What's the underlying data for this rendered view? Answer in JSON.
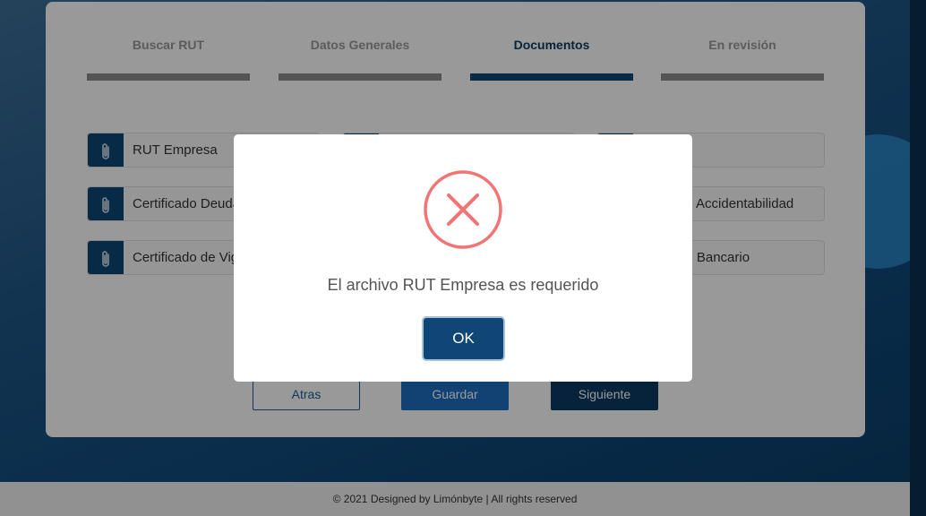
{
  "steps": [
    {
      "label": "Buscar RUT",
      "active": false
    },
    {
      "label": "Datos Generales",
      "active": false
    },
    {
      "label": "Documentos",
      "active": true
    },
    {
      "label": "En revisión",
      "active": false
    }
  ],
  "documents": {
    "col1": [
      "RUT Empresa",
      "Certificado Deuda",
      "Certificado de Vig"
    ],
    "col3": [
      "a",
      "do Accidentabilidad",
      "do Bancario"
    ]
  },
  "buttons": {
    "back": "Atras",
    "save": "Guardar",
    "next": "Siguiente"
  },
  "footer": {
    "text": "© 2021 Designed by Limónbyte | All rights reserved"
  },
  "modal": {
    "icon": "error-x-icon",
    "message": "El archivo RUT Empresa es requerido",
    "ok_label": "OK"
  },
  "colors": {
    "primary": "#0d4677",
    "error": "#f27474",
    "step_inactive": "#8c8c8c"
  }
}
